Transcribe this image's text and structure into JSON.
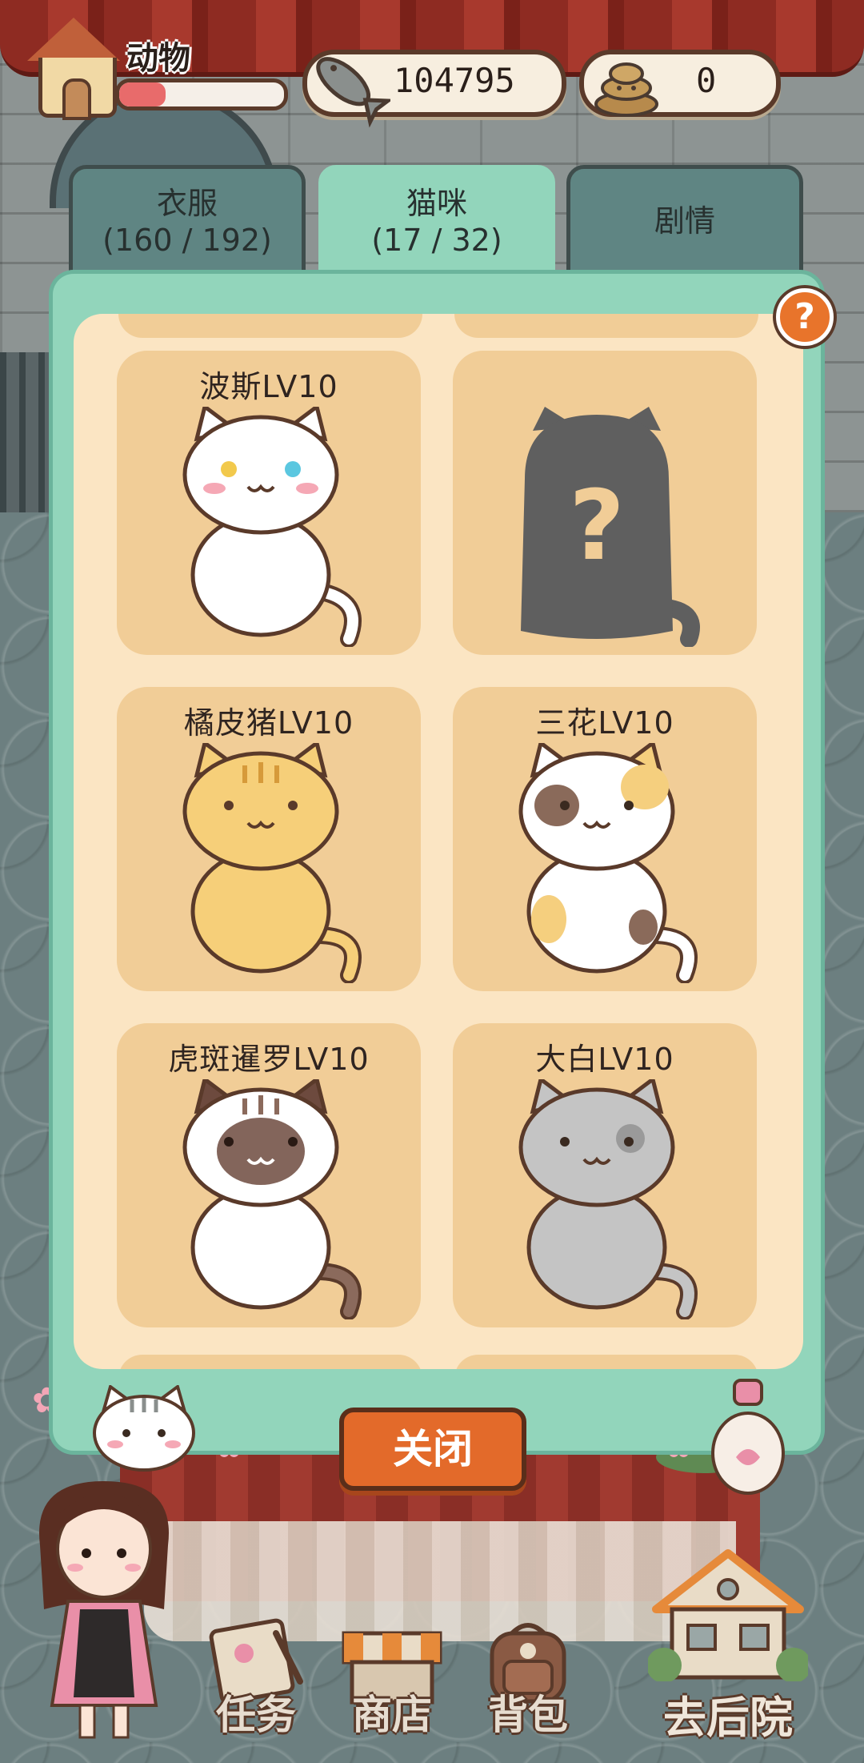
{
  "top_bar": {
    "level_title": "动物",
    "exp_progress": 0.28,
    "fish_count": "104795",
    "poop_count": "0"
  },
  "tabs": [
    {
      "label": "衣服",
      "count": "(160 / 192)",
      "active": false
    },
    {
      "label": "猫咪",
      "count": "(17 / 32)",
      "active": true
    },
    {
      "label": "剧情",
      "count": "",
      "active": false
    }
  ],
  "help_label": "?",
  "cats": [
    {
      "name": "波斯LV10",
      "unlocked": true,
      "coat": "persian"
    },
    {
      "name": "",
      "unlocked": false,
      "coat": "locked"
    },
    {
      "name": "橘皮猪LV10",
      "unlocked": true,
      "coat": "orange"
    },
    {
      "name": "三花LV10",
      "unlocked": true,
      "coat": "calico"
    },
    {
      "name": "虎斑暹罗LV10",
      "unlocked": true,
      "coat": "siamese"
    },
    {
      "name": "大白LV10",
      "unlocked": true,
      "coat": "grey"
    }
  ],
  "close_label": "关闭",
  "bottom_menu": {
    "task": "任务",
    "shop": "商店",
    "bag": "背包",
    "backyard": "去后院"
  },
  "colors": {
    "panel_green": "#92d5bb",
    "panel_cream": "#fbe5c3",
    "card_tan": "#f1cd97",
    "close_orange": "#e36a2a",
    "outline_brown": "#5a3a2a"
  }
}
